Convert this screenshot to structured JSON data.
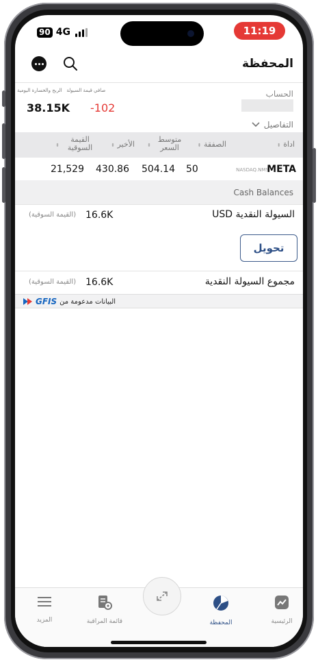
{
  "status_bar": {
    "battery": "90",
    "network": "4G",
    "time": "11:19"
  },
  "header": {
    "title": "المحفظة"
  },
  "account": {
    "label": "الحساب",
    "daily_pl_label": "الربح والخسارة اليومية",
    "net_liquidity_label": "صافي قيمة السيولة",
    "net_liquidity_value": "38.15K",
    "daily_pl_value": "-102",
    "details_label": "التفاصيل"
  },
  "table": {
    "headers": {
      "instrument": "اداة",
      "position": "الصفقة",
      "avg_price": "متوسط السعر",
      "last": "الأخير",
      "market_value": "القيمة السوقية"
    },
    "rows": [
      {
        "symbol": "META",
        "exchange": "NASDAQ.NMS",
        "position": "50",
        "avg_price": "504.14",
        "last": "430.86",
        "market_value": "21,529"
      }
    ]
  },
  "cash": {
    "header": "Cash Balances",
    "usd_label": "السيولة النقدية USD",
    "usd_value": "16.6K",
    "market_value_label": "(القيمة السوقية)",
    "convert_label": "تحويل",
    "total_label": "مجموع السيولة النقدية",
    "total_value": "16.6K"
  },
  "data_source": {
    "text": "البيانات مدعومة من",
    "logo": "GFIS"
  },
  "tabbar": {
    "items": [
      {
        "label": "الرئيسية",
        "icon": "chart-icon"
      },
      {
        "label": "المحفظة",
        "icon": "pie-chart-icon",
        "active": true
      },
      {
        "label": "قائمة المراقبة",
        "icon": "watchlist-icon"
      },
      {
        "label": "المزيد",
        "icon": "menu-icon"
      }
    ]
  },
  "colors": {
    "accent": "#2d4f86",
    "negative": "#e53935"
  }
}
